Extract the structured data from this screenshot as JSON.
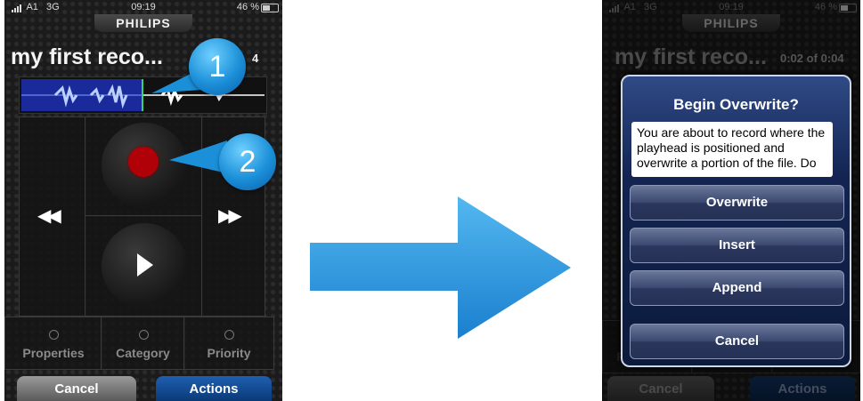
{
  "status_bar": {
    "carrier": "A1",
    "network": "3G",
    "time": "09:19",
    "battery": "46 %"
  },
  "brand": "PHILIPS",
  "recording": {
    "title": "my first reco...",
    "title_right": "my first reco...",
    "time_partial": "4",
    "time_position": "0:02",
    "time_of": "of",
    "time_total": "0:04"
  },
  "controls": {
    "rewind_icon": "rewind-icon",
    "forward_icon": "fast-forward-icon"
  },
  "meta": [
    {
      "label": "Properties"
    },
    {
      "label": "Category"
    },
    {
      "label": "Priority"
    }
  ],
  "buttons": {
    "cancel": "Cancel",
    "actions": "Actions"
  },
  "callouts": {
    "one": "1",
    "two": "2"
  },
  "dialog": {
    "title": "Begin Overwrite?",
    "message": "You are about to record where the playhead is positioned and overwrite a portion of the file. Do",
    "options": [
      "Overwrite",
      "Insert",
      "Append"
    ],
    "cancel": "Cancel"
  },
  "colors": {
    "accent_blue": "#1b8fd8",
    "record_red": "#b00008",
    "played_wave": "#1b2a9a",
    "playhead": "#3cd25b"
  }
}
